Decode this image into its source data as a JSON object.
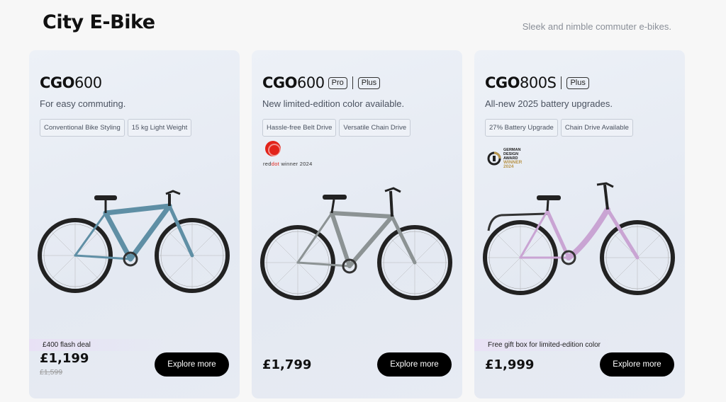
{
  "header": {
    "title": "City E-Bike",
    "subtitle": "Sleek and nimble commuter e-bikes."
  },
  "cards": [
    {
      "model_bold": "CGO",
      "model_num": "600",
      "badges": [],
      "tagline": "For easy commuting.",
      "chips": [
        "Conventional Bike Styling",
        "15 kg Light Weight"
      ],
      "deal": "£400 flash deal",
      "price": "£1,199",
      "old_price": "£1,599",
      "button": "Explore more",
      "frame_color": "#5f8fa5"
    },
    {
      "model_bold": "CGO",
      "model_num": "600",
      "badges": [
        "Pro",
        "Plus"
      ],
      "tagline": "New limited-edition color available.",
      "chips": [
        "Hassle-free Belt Drive",
        "Versatile Chain Drive"
      ],
      "award": {
        "brand_a": "red",
        "brand_b": "dot",
        "rest": " winner 2024"
      },
      "price": "£1,799",
      "button": "Explore more",
      "frame_color": "#8c9394"
    },
    {
      "model_bold": "CGO",
      "model_num": "800S",
      "badges": [
        "Plus"
      ],
      "tagline": "All-new 2025 battery upgrades.",
      "chips": [
        "27% Battery Upgrade",
        "Chain Drive Available"
      ],
      "award": {
        "line1": "GERMAN",
        "line2": "DESIGN",
        "line3": "AWARD",
        "line4": "WINNER",
        "line5": "2024"
      },
      "deal": "Free gift box for limited-edition color",
      "price": "£1,999",
      "button": "Explore more",
      "frame_color": "#c9a4d3"
    }
  ]
}
